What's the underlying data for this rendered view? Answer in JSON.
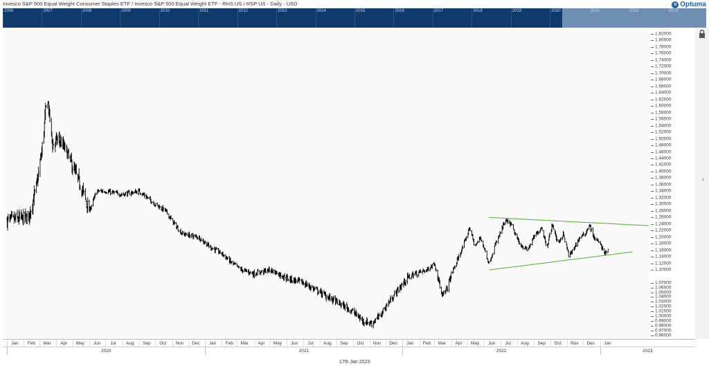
{
  "header": {
    "title": "Invesco S&P 500 Equal Weight Consumer Staples ETF / Invesco S&P 500 Equal Weight ETF - RHS:US / RSP:US - Daily - USD",
    "logo_text": "Optuma"
  },
  "navigator": {
    "years": [
      "2006",
      "2007",
      "2008",
      "2009",
      "2010",
      "2011",
      "2012",
      "2013",
      "2014",
      "2015",
      "2016",
      "2017",
      "2018",
      "2019",
      "2020",
      "2021",
      "2022",
      "2023"
    ]
  },
  "footer": {
    "date": "17th Jan 2023"
  },
  "colors": {
    "navigator_bg": "#0f3a6c",
    "navigator_window": "#6f8fb2",
    "price": "#000000",
    "trendline": "#4caf2a"
  },
  "chart_data": {
    "type": "ohlc",
    "ylim": [
      0.95,
      1.84
    ],
    "y_axis_side": "right",
    "y_ticks": [
      "1.82000",
      "1.80000",
      "1.78000",
      "1.76000",
      "1.74000",
      "1.72000",
      "1.70000",
      "1.68000",
      "1.66000",
      "1.64000",
      "1.62000",
      "1.60000",
      "1.58000",
      "1.56000",
      "1.54000",
      "1.52000",
      "1.50000",
      "1.48000",
      "1.46000",
      "1.44000",
      "1.42000",
      "1.40000",
      "1.38000",
      "1.36000",
      "1.34000",
      "1.32000",
      "1.30000",
      "1.28000",
      "1.26000",
      "1.24000",
      "1.22000",
      "1.20000",
      "1.18000",
      "1.16000",
      "1.14000",
      "1.12000",
      "1.10000",
      "1.07000",
      "1.06000",
      "1.05000",
      "1.04000",
      "1.03000",
      "1.02000",
      "1.01000",
      "1.00000",
      "0.99000",
      "0.98000",
      "0.97000",
      "0.96000"
    ],
    "month_labels": [
      "Jan",
      "Feb",
      "Mar",
      "Apr",
      "May",
      "Jun",
      "Jul",
      "Aug",
      "Sep",
      "Oct",
      "Nov",
      "Dec",
      "Jan",
      "Feb",
      "Mar",
      "Apr",
      "May",
      "Jun",
      "Jul",
      "Aug",
      "Sep",
      "Oct",
      "Nov",
      "Dec",
      "Jan",
      "Feb",
      "Mar",
      "Apr",
      "May",
      "Jun",
      "Jul",
      "Aug",
      "Sep",
      "Oct",
      "Nov",
      "Dec",
      "Jan"
    ],
    "year_labels": [
      "2020",
      "2021",
      "2022",
      "2023"
    ],
    "anchors": [
      [
        "2020-01-01",
        1.25
      ],
      [
        "2020-02-10",
        1.26
      ],
      [
        "2020-02-25",
        1.36
      ],
      [
        "2020-03-05",
        1.46
      ],
      [
        "2020-03-12",
        1.58
      ],
      [
        "2020-03-16",
        1.62
      ],
      [
        "2020-03-25",
        1.48
      ],
      [
        "2020-04-05",
        1.5
      ],
      [
        "2020-04-20",
        1.46
      ],
      [
        "2020-05-05",
        1.4
      ],
      [
        "2020-05-20",
        1.34
      ],
      [
        "2020-06-01",
        1.28
      ],
      [
        "2020-06-15",
        1.34
      ],
      [
        "2020-07-01",
        1.34
      ],
      [
        "2020-08-01",
        1.33
      ],
      [
        "2020-09-01",
        1.34
      ],
      [
        "2020-10-01",
        1.3
      ],
      [
        "2020-10-20",
        1.28
      ],
      [
        "2020-11-05",
        1.24
      ],
      [
        "2020-11-20",
        1.21
      ],
      [
        "2020-12-20",
        1.2
      ],
      [
        "2021-01-10",
        1.17
      ],
      [
        "2021-02-01",
        1.15
      ],
      [
        "2021-02-20",
        1.12
      ],
      [
        "2021-03-10",
        1.1
      ],
      [
        "2021-04-01",
        1.09
      ],
      [
        "2021-05-01",
        1.1
      ],
      [
        "2021-06-01",
        1.08
      ],
      [
        "2021-07-01",
        1.07
      ],
      [
        "2021-08-01",
        1.05
      ],
      [
        "2021-09-01",
        1.03
      ],
      [
        "2021-10-01",
        1.01
      ],
      [
        "2021-10-20",
        0.99
      ],
      [
        "2021-11-05",
        0.985
      ],
      [
        "2021-11-20",
        1.0
      ],
      [
        "2021-12-01",
        1.02
      ],
      [
        "2021-12-20",
        1.05
      ],
      [
        "2022-01-10",
        1.08
      ],
      [
        "2022-01-25",
        1.09
      ],
      [
        "2022-02-15",
        1.1
      ],
      [
        "2022-03-01",
        1.12
      ],
      [
        "2022-03-15",
        1.04
      ],
      [
        "2022-03-25",
        1.06
      ],
      [
        "2022-04-10",
        1.12
      ],
      [
        "2022-04-25",
        1.18
      ],
      [
        "2022-05-05",
        1.23
      ],
      [
        "2022-05-15",
        1.17
      ],
      [
        "2022-05-25",
        1.2
      ],
      [
        "2022-06-10",
        1.12
      ],
      [
        "2022-06-20",
        1.17
      ],
      [
        "2022-07-10",
        1.25
      ],
      [
        "2022-07-20",
        1.24
      ],
      [
        "2022-08-05",
        1.18
      ],
      [
        "2022-08-20",
        1.16
      ],
      [
        "2022-09-01",
        1.2
      ],
      [
        "2022-09-15",
        1.23
      ],
      [
        "2022-09-25",
        1.17
      ],
      [
        "2022-10-05",
        1.24
      ],
      [
        "2022-10-15",
        1.18
      ],
      [
        "2022-10-25",
        1.21
      ],
      [
        "2022-11-05",
        1.14
      ],
      [
        "2022-11-15",
        1.17
      ],
      [
        "2022-11-25",
        1.2
      ],
      [
        "2022-12-05",
        1.21
      ],
      [
        "2022-12-12",
        1.24
      ],
      [
        "2022-12-20",
        1.2
      ],
      [
        "2023-01-01",
        1.18
      ],
      [
        "2023-01-10",
        1.15
      ],
      [
        "2023-01-17",
        1.16
      ]
    ],
    "trendlines": [
      {
        "name": "upper",
        "from": [
          "2022-06-10",
          1.26
        ],
        "to": [
          "2023-04-01",
          1.235
        ]
      },
      {
        "name": "lower",
        "from": [
          "2022-06-10",
          1.1
        ],
        "to": [
          "2023-03-02",
          1.155
        ]
      }
    ]
  }
}
